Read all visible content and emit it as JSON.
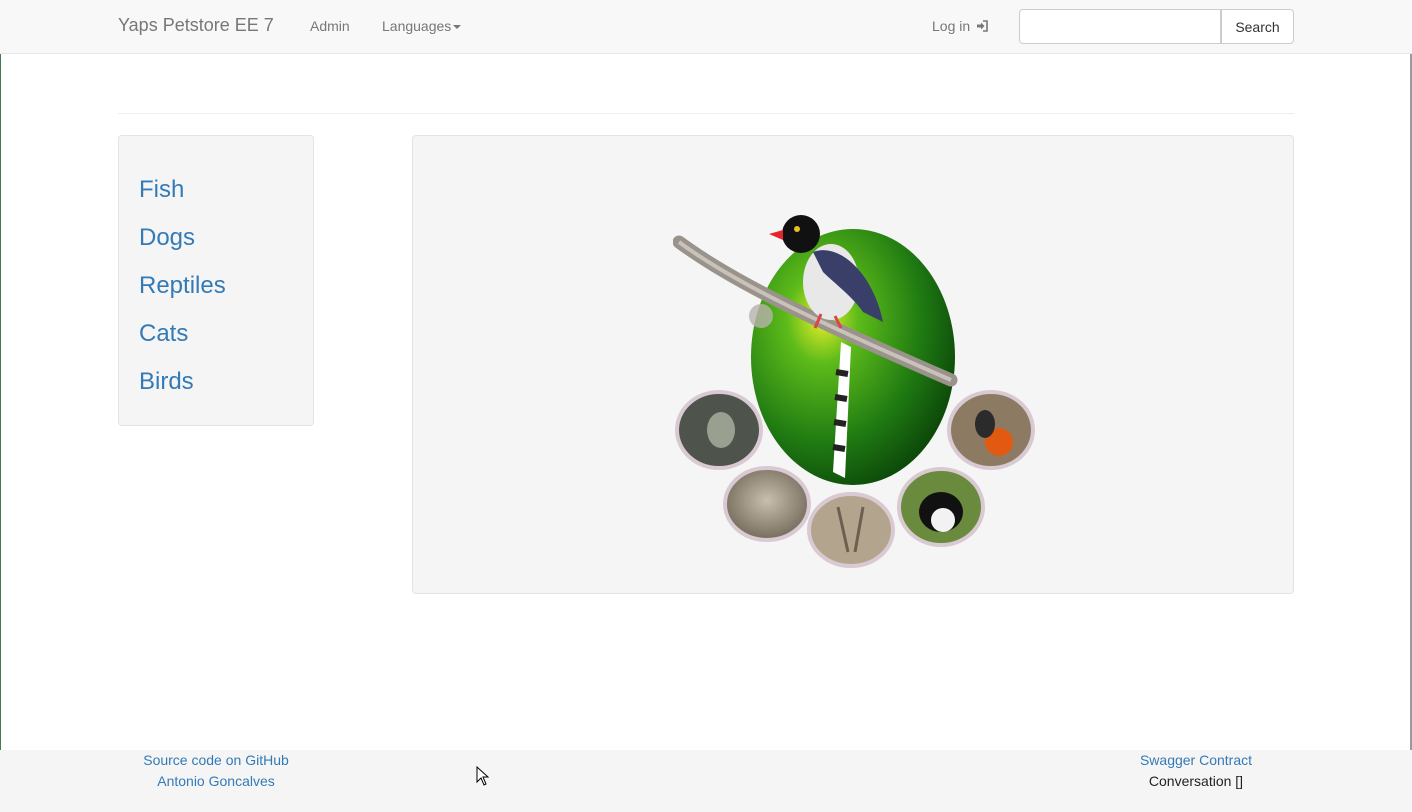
{
  "navbar": {
    "brand": "Yaps Petstore EE 7",
    "admin": "Admin",
    "languages": "Languages",
    "login": "Log in",
    "search_value": "",
    "search_button": "Search"
  },
  "sidebar": {
    "categories": [
      {
        "label": "Fish"
      },
      {
        "label": "Dogs"
      },
      {
        "label": "Reptiles"
      },
      {
        "label": "Cats"
      },
      {
        "label": "Birds"
      }
    ]
  },
  "footer": {
    "source_link": "Source code on GitHub",
    "author_link": "Antonio Goncalves",
    "swagger_link": "Swagger Contract",
    "conversation": "Conversation []"
  },
  "icons": {
    "login": "sign-in-icon",
    "dropdown": "caret-down-icon",
    "cursor": "mouse-pointer-icon"
  },
  "colors": {
    "link": "#337ab7",
    "navbar_bg": "#f8f8f8",
    "panel_bg": "#f5f5f5"
  }
}
